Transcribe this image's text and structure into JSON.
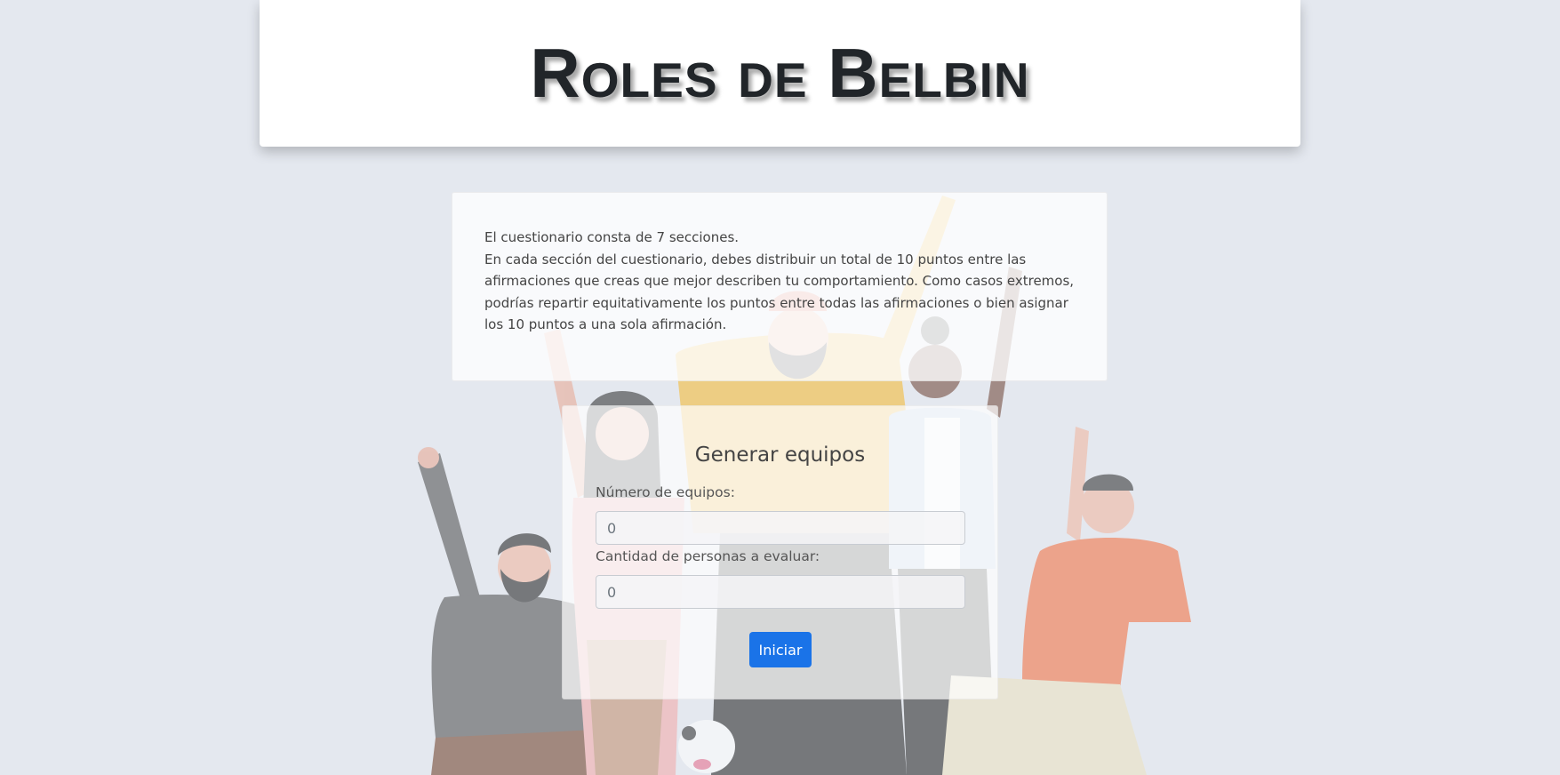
{
  "header": {
    "title": "Roles de Belbin"
  },
  "intro": {
    "line1": "El cuestionario consta de 7 secciones.",
    "line2": "En cada sección del cuestionario, debes distribuir un total de 10 puntos entre las afirmaciones que creas que mejor describen tu comportamiento. Como casos extremos, podrías repartir equitativamente los puntos entre todas las afirmaciones o bien asignar los 10 puntos a una sola afirmación."
  },
  "form": {
    "title": "Generar equipos",
    "teams_label": "Número de equipos:",
    "teams_placeholder": "0",
    "people_label": "Cantidad de personas a evaluar:",
    "people_placeholder": "0",
    "submit_label": "Iniciar"
  },
  "colors": {
    "background": "#e4e8ef",
    "primary_button": "#1a73e8",
    "title_text": "#212529"
  }
}
